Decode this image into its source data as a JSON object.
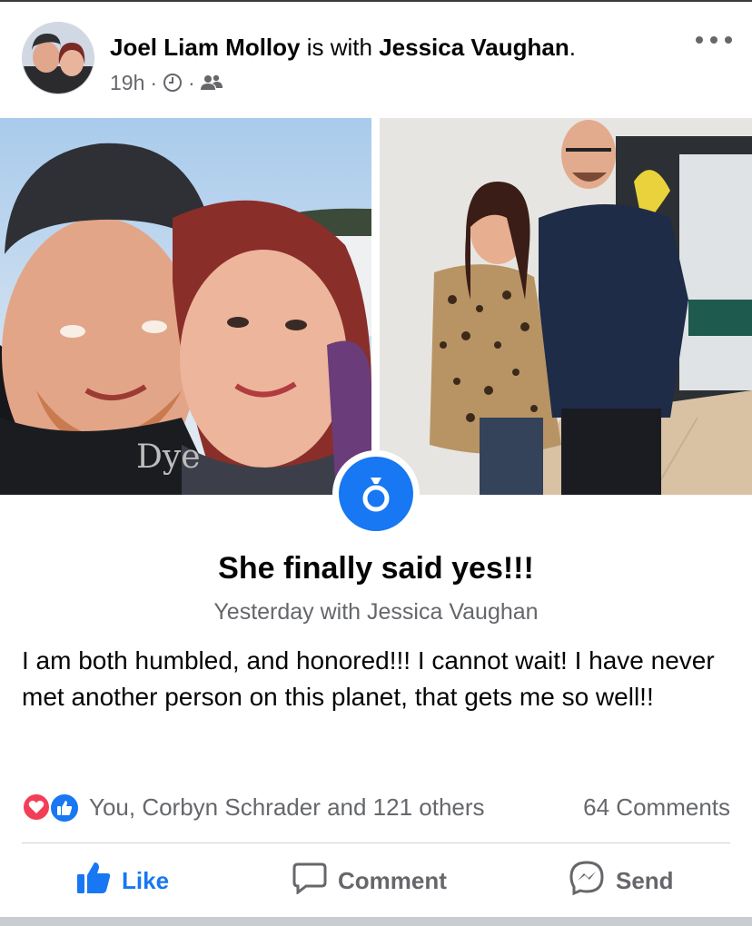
{
  "post": {
    "author": "Joel Liam Molloy",
    "with_text": " is with ",
    "tagged": "Jessica Vaughan",
    "period": ".",
    "time": "19h",
    "separator": "·",
    "audience_icon": "friends-icon",
    "privacy_icon": "clock-icon"
  },
  "life_event": {
    "icon": "ring-icon",
    "title": "She finally said yes!!!",
    "subtitle": "Yesterday with Jessica Vaughan"
  },
  "body_text": "I am both humbled, and honored!!! I cannot wait! I have never met another person on this planet, that gets me so well!!",
  "engagement": {
    "reactions_text": "You, Corbyn Schrader and 121 others",
    "comments_text": "64 Comments",
    "reaction_icons": [
      "love-icon",
      "like-icon"
    ]
  },
  "actions": {
    "like": "Like",
    "comment": "Comment",
    "send": "Send"
  },
  "colors": {
    "accent": "#1877f2",
    "text_secondary": "#65676b",
    "love": "#f33e58"
  }
}
